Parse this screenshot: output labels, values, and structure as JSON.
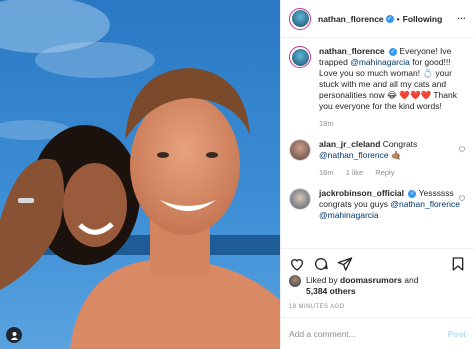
{
  "header": {
    "username": "nathan_florence",
    "separator": "•",
    "follow_label": "Following",
    "more_label": "..."
  },
  "caption": {
    "username": "nathan_florence",
    "text_1": "Everyone! Ive trapped",
    "mention": "@mahinagarcia",
    "text_2": "for good!!! Love you so much woman! 💍 your stuck with me and all my cats and personalities now 😂",
    "hearts": "❤️❤️❤️",
    "text_3": "Thank you everyone for the kind words!",
    "time": "18m"
  },
  "comments": [
    {
      "username": "alan_jr_cleland",
      "text": "Congrats",
      "mention": "@nathan_florence",
      "emoji": "🤙🏽",
      "time": "16m",
      "likes": "1 like",
      "reply": "Reply"
    },
    {
      "username": "jackrobinson_official",
      "text": "Yessssss congrats you guys",
      "mention_1": "@nathan_florence",
      "mention_2": "@mahinagarcia"
    }
  ],
  "likes": {
    "prefix": "Liked by",
    "user": "doomasrumors",
    "conj": "and",
    "count": "5,384 others"
  },
  "timestamp": "18 MINUTES AGO",
  "add_comment": {
    "placeholder": "Add a comment...",
    "post_label": "Post"
  },
  "icons": [
    "heart-icon",
    "comment-icon",
    "share-icon",
    "bookmark-icon",
    "user-tag-icon",
    "verified-badge-icon"
  ],
  "colors": {
    "verified": "#3897f0",
    "link": "#00376b",
    "muted": "#8e8e8e",
    "post_disabled": "#b2dffc"
  }
}
